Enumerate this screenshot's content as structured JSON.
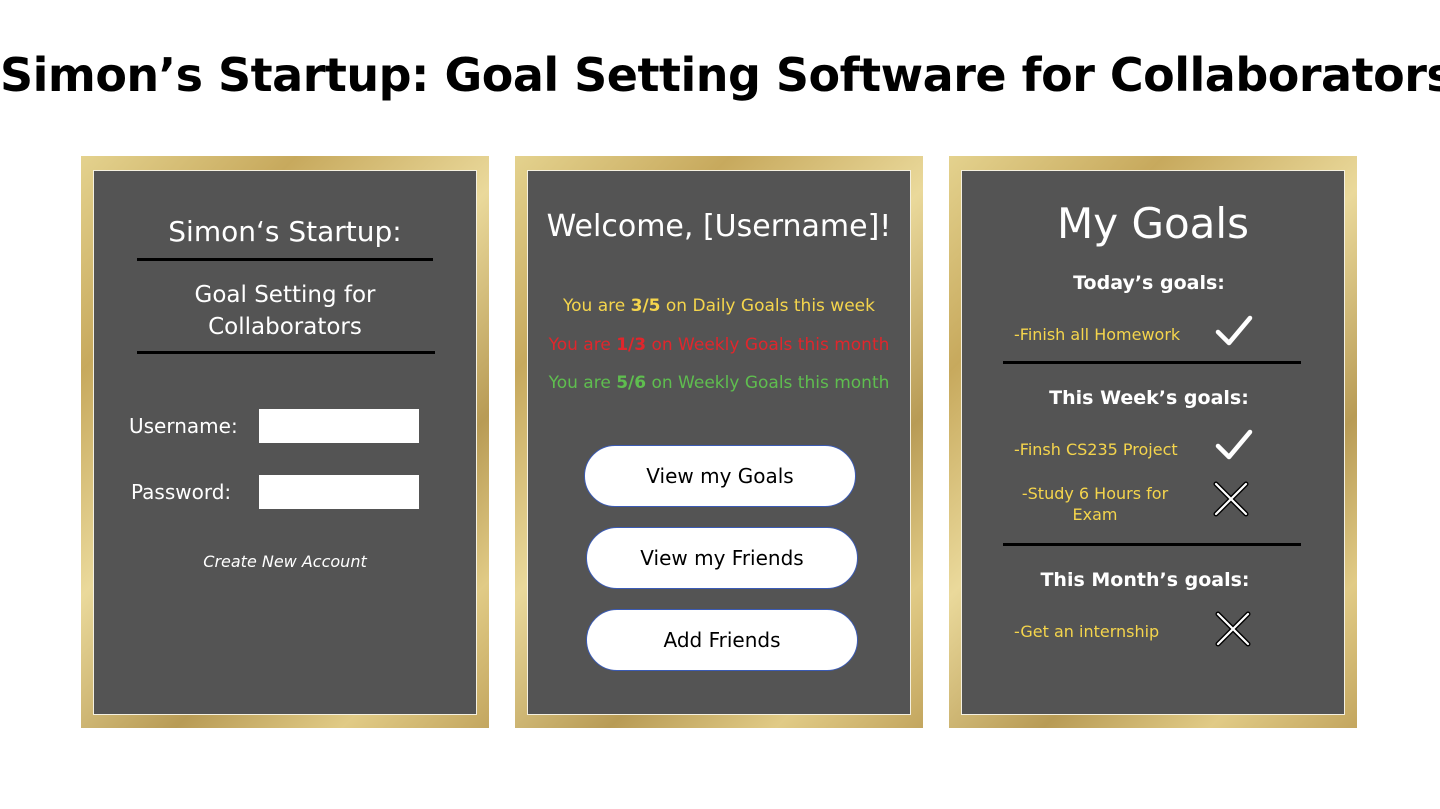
{
  "page": {
    "title": "Simon’s Startup: Goal Setting Software for Collaborators"
  },
  "login": {
    "app_title": "Simon‘s Startup:",
    "subtitle_line1": "Goal Setting for",
    "subtitle_line2": "Collaborators",
    "username_label": "Username:",
    "username_value": "",
    "password_label": "Password:",
    "password_value": "",
    "create_account": "Create New Account"
  },
  "home": {
    "welcome": "Welcome, [Username]!",
    "stats": [
      {
        "prefix": "You are ",
        "value": "3/5",
        "suffix": " on Daily Goals this week",
        "color": "#f5d54c"
      },
      {
        "prefix": "You are ",
        "value": "1/3",
        "suffix": " on Weekly Goals this month",
        "color": "#e0262c"
      },
      {
        "prefix": "You are ",
        "value": "5/6",
        "suffix": " on Weekly Goals this month",
        "color": "#5fbe4f"
      }
    ],
    "buttons": {
      "view_goals": "View my Goals",
      "view_friends": "View my Friends",
      "add_friends": "Add Friends"
    }
  },
  "goals": {
    "title": "My Goals",
    "sections": [
      {
        "heading": "Today’s goals:",
        "items": [
          {
            "text": "-Finish all Homework",
            "status_icon": "check-icon"
          }
        ]
      },
      {
        "heading": "This Week’s goals:",
        "items": [
          {
            "text": "-Finsh CS235 Project",
            "status_icon": "check-icon"
          },
          {
            "text_line1": "-Study 6 Hours for",
            "text_line2": "Exam",
            "status_icon": "x-icon"
          }
        ]
      },
      {
        "heading": "This Month’s goals:",
        "items": [
          {
            "text": "-Get an internship",
            "status_icon": "x-icon"
          }
        ]
      }
    ]
  },
  "colors": {
    "panel_bg": "#545454",
    "frame_gold": "#d4bb72",
    "goal_text": "#f5d54c",
    "button_border": "#3b5bb5"
  }
}
